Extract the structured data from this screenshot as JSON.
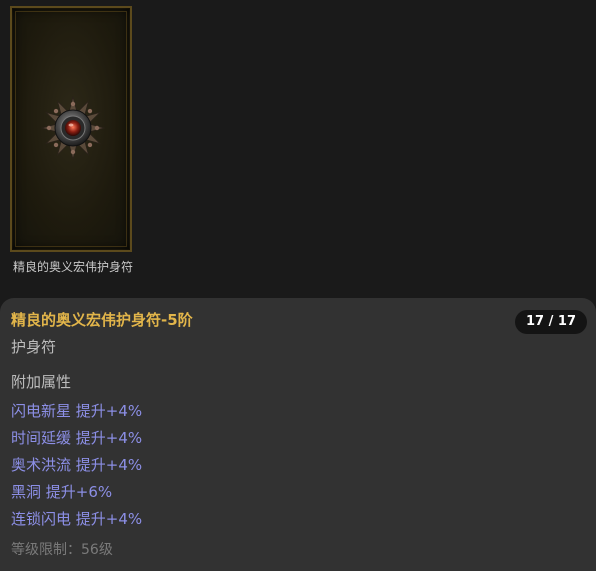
{
  "item": {
    "caption": "精良的奥义宏伟护身符",
    "icon": "amulet-icon"
  },
  "tooltip": {
    "title": "精良的奥义宏伟护身符-5阶",
    "count": "17 / 17",
    "type": "护身符",
    "section_label": "附加属性",
    "attributes": [
      "闪电新星 提升+4%",
      "时间延缓 提升+4%",
      "奥术洪流 提升+4%",
      "黑洞 提升+6%",
      "连锁闪电 提升+4%"
    ],
    "level_requirement": "等级限制：56级"
  },
  "colors": {
    "title": "#e2b54a",
    "attribute": "#8c8fe6",
    "panel_bg": "#323232",
    "page_bg": "#1a1a1a"
  }
}
